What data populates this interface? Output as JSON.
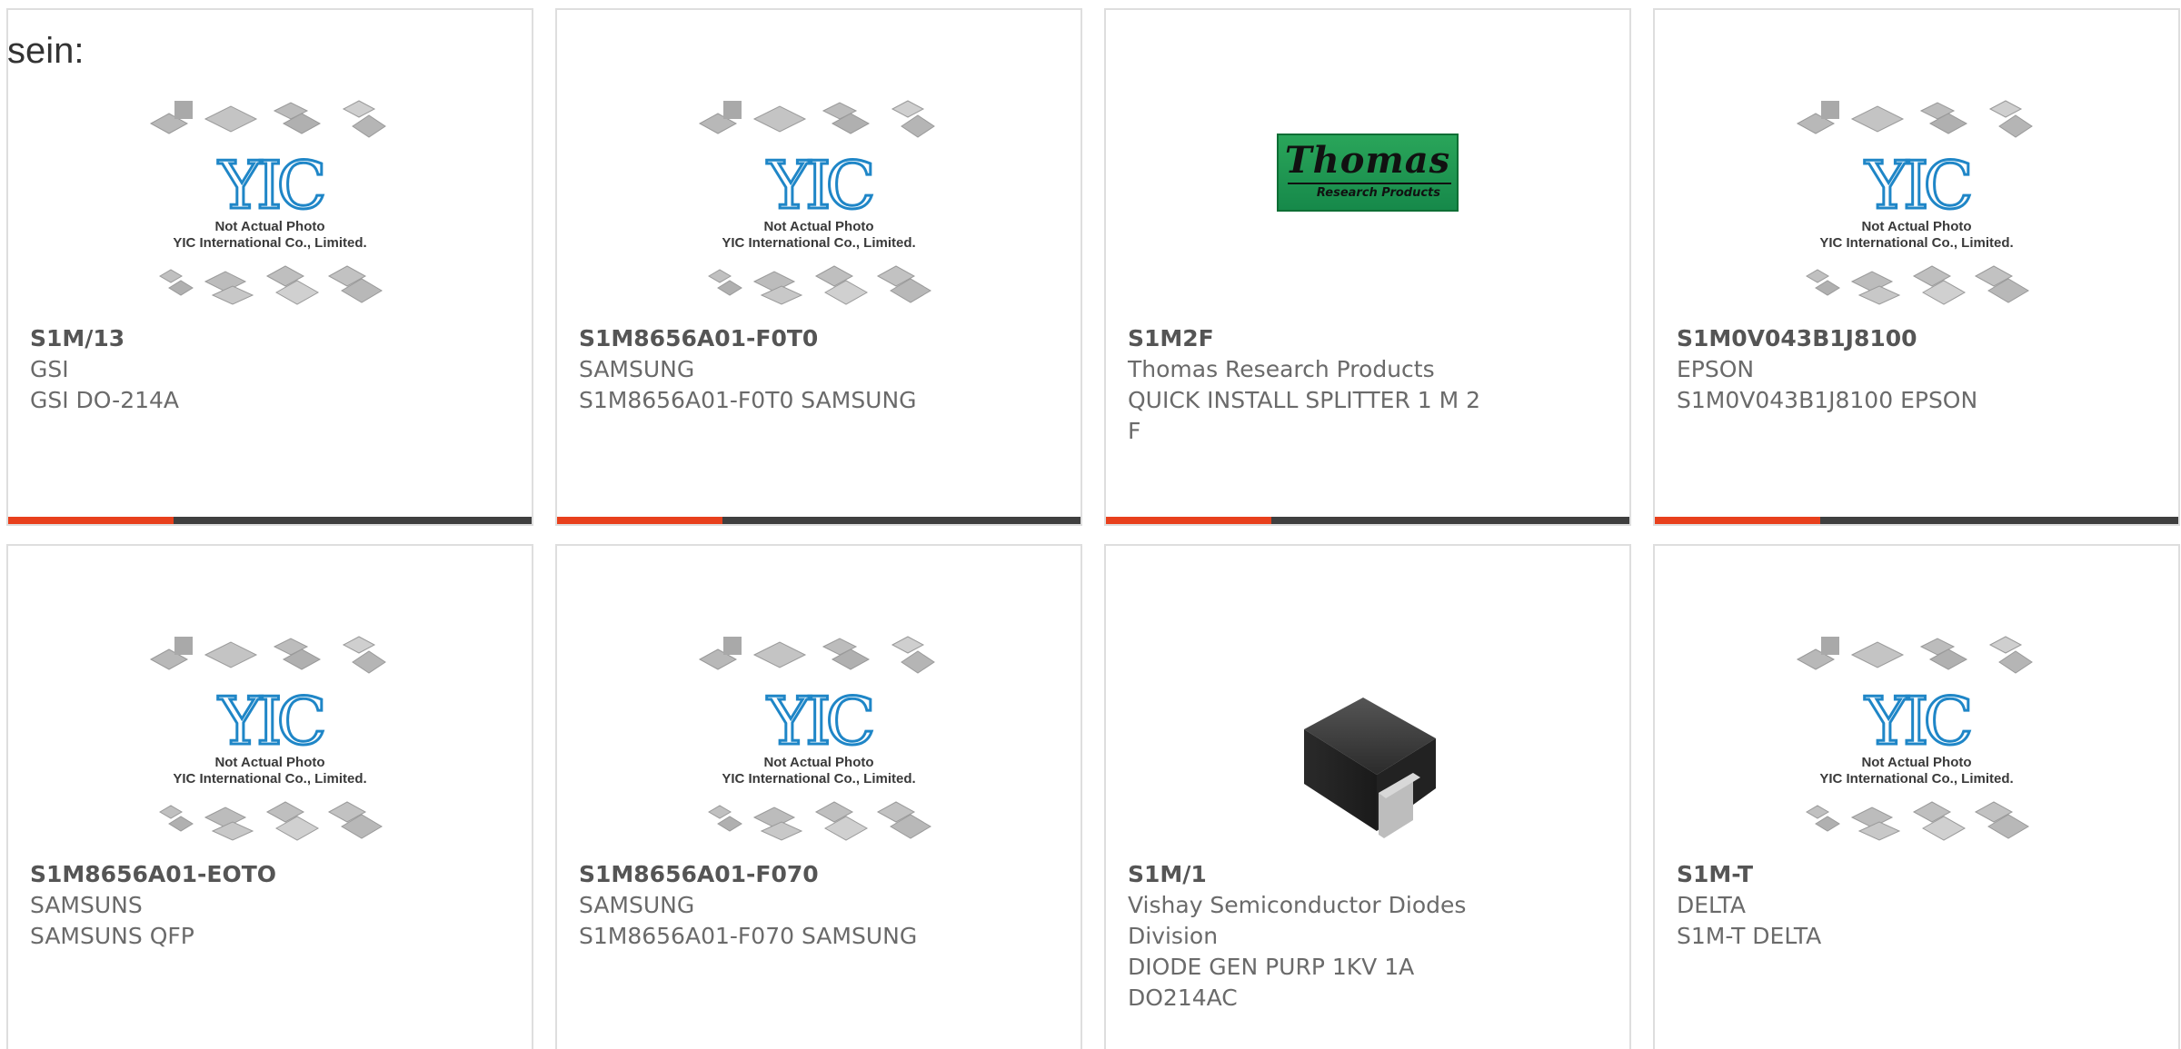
{
  "intro_text": "sein:",
  "placeholder": {
    "line1": "Not Actual Photo",
    "line2": "YIC International Co., Limited.",
    "logo": "YIC"
  },
  "thomas_logo": {
    "main": "Thomas",
    "sub": "Research Products"
  },
  "colors": {
    "accent": "#e8401c",
    "bar": "#3f3f3f",
    "yic_blue": "#1f86c7",
    "thomas_green": "#1f9a52"
  },
  "products": [
    {
      "part_no": "S1M/13",
      "brand": "GSI",
      "desc_lines": [
        "GSI DO-214A"
      ],
      "image": "yic-placeholder"
    },
    {
      "part_no": "S1M8656A01-F0T0",
      "brand": "SAMSUNG",
      "desc_lines": [
        "S1M8656A01-F0T0 SAMSUNG"
      ],
      "image": "yic-placeholder"
    },
    {
      "part_no": "S1M2F",
      "brand": "Thomas Research Products",
      "desc_lines": [
        "QUICK INSTALL SPLITTER 1 M 2",
        "F"
      ],
      "image": "thomas-logo"
    },
    {
      "part_no": "S1M0V043B1J8100",
      "brand": "EPSON",
      "desc_lines": [
        "S1M0V043B1J8100 EPSON"
      ],
      "image": "yic-placeholder"
    },
    {
      "part_no": "S1M8656A01-EOTO",
      "brand": "SAMSUNS",
      "desc_lines": [
        "SAMSUNS QFP"
      ],
      "image": "yic-placeholder"
    },
    {
      "part_no": "S1M8656A01-F070",
      "brand": "SAMSUNG",
      "desc_lines": [
        "S1M8656A01-F070 SAMSUNG"
      ],
      "image": "yic-placeholder"
    },
    {
      "part_no": "S1M/1",
      "brand_lines": [
        "Vishay Semiconductor Diodes",
        "Division"
      ],
      "desc_lines": [
        "DIODE GEN PURP 1KV 1A",
        "DO214AC"
      ],
      "image": "diode-photo"
    },
    {
      "part_no": "S1M-T",
      "brand": "DELTA",
      "desc_lines": [
        "S1M-T DELTA"
      ],
      "image": "yic-placeholder"
    }
  ]
}
